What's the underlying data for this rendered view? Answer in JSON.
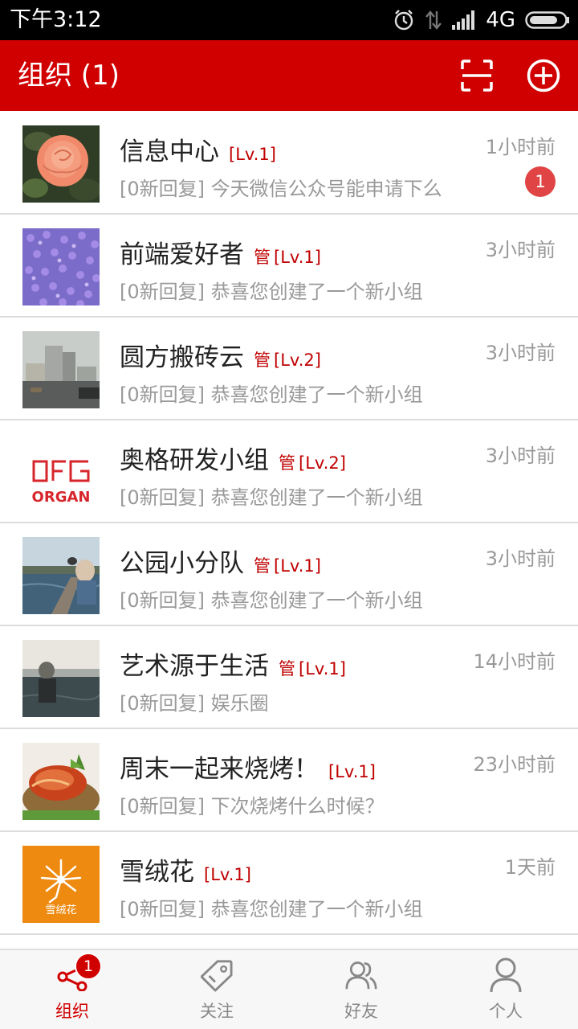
{
  "status_bar": {
    "time": "下午3:12",
    "network": "4G",
    "icons": [
      "alarm-icon",
      "data-arrows-icon",
      "signal-icon",
      "battery-icon"
    ],
    "battery_level": 0.85
  },
  "header": {
    "title": "组织 (1)",
    "background_color": "#d10000",
    "actions": [
      "scan-icon",
      "add-circle-icon"
    ]
  },
  "groups": [
    {
      "name": "信息中心",
      "admin": "",
      "level": "[Lv.1]",
      "time": "1小时前",
      "preview": "[0新回复] 今天微信公众号能申请下么",
      "unread": "1"
    },
    {
      "name": "前端爱好者",
      "admin": "管",
      "level": "[Lv.1]",
      "time": "3小时前",
      "preview": "[0新回复] 恭喜您创建了一个新小组",
      "unread": ""
    },
    {
      "name": "圆方搬砖云",
      "admin": "管",
      "level": "[Lv.2]",
      "time": "3小时前",
      "preview": "[0新回复] 恭喜您创建了一个新小组",
      "unread": ""
    },
    {
      "name": "奥格研发小组",
      "admin": "管",
      "level": "[Lv.2]",
      "time": "3小时前",
      "preview": "[0新回复] 恭喜您创建了一个新小组",
      "unread": "",
      "logo_text": "ORGAN"
    },
    {
      "name": "公园小分队",
      "admin": "管",
      "level": "[Lv.1]",
      "time": "3小时前",
      "preview": "[0新回复] 恭喜您创建了一个新小组",
      "unread": ""
    },
    {
      "name": "艺术源于生活",
      "admin": "管",
      "level": "[Lv.1]",
      "time": "14小时前",
      "preview": "[0新回复] 娱乐圈",
      "unread": ""
    },
    {
      "name": "周末一起来烧烤！",
      "admin": "",
      "level": "[Lv.1]",
      "time": "23小时前",
      "preview": "[0新回复] 下次烧烤什么时候？",
      "unread": ""
    },
    {
      "name": "雪绒花",
      "admin": "",
      "level": "[Lv.1]",
      "time": "1天前",
      "preview": "[0新回复] 恭喜您创建了一个新小组",
      "unread": "",
      "logo_text": "雪绒花"
    }
  ],
  "tabs": [
    {
      "label": "组织",
      "icon": "share-nodes-icon",
      "active": true,
      "badge": "1"
    },
    {
      "label": "关注",
      "icon": "tag-icon",
      "active": false,
      "badge": ""
    },
    {
      "label": "好友",
      "icon": "friends-icon",
      "active": false,
      "badge": ""
    },
    {
      "label": "个人",
      "icon": "person-icon",
      "active": false,
      "badge": ""
    }
  ],
  "colors": {
    "accent": "#d10000",
    "level_tag": "#c00000",
    "muted_text": "#999999",
    "badge": "#e04444"
  }
}
